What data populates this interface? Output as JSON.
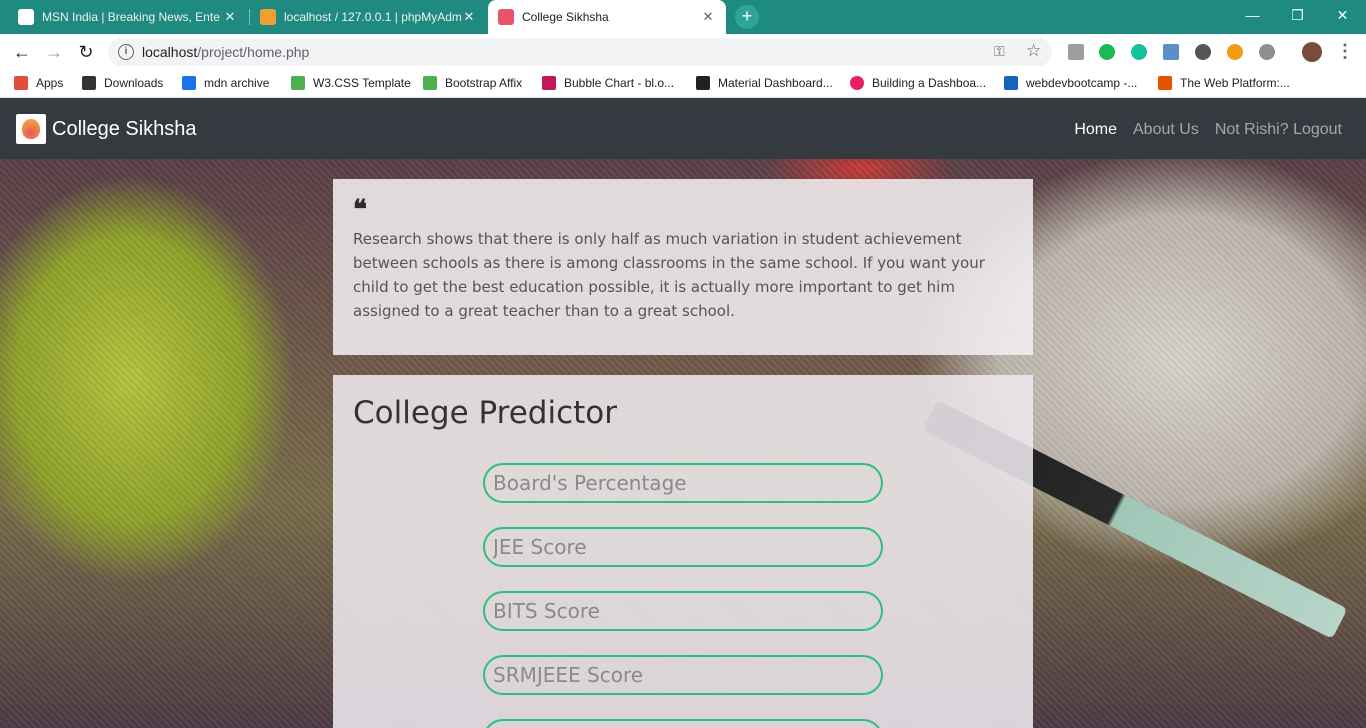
{
  "browser": {
    "tabs": [
      {
        "title": "MSN India | Breaking News, Ente",
        "close": "✕",
        "favicon_color": "#ffffff"
      },
      {
        "title": "localhost / 127.0.0.1 | phpMyAdm",
        "close": "✕",
        "favicon_color": "#f0a030"
      },
      {
        "title": "College Sikhsha",
        "close": "✕",
        "favicon_color": "#e8536a"
      }
    ],
    "new_tab": "+",
    "window_controls": {
      "minimize": "—",
      "maximize": "❐",
      "close": "✕"
    },
    "address": {
      "host": "localhost",
      "path": "/project/home.php"
    },
    "bookmarks": [
      {
        "label": "Apps",
        "icon_color": "#e34b3c"
      },
      {
        "label": "Downloads",
        "icon_color": "#333333"
      },
      {
        "label": "mdn archive",
        "icon_color": "#1a73e8"
      },
      {
        "label": "W3.CSS Template",
        "icon_color": "#4caf50"
      },
      {
        "label": "Bootstrap Affix",
        "icon_color": "#4caf50"
      },
      {
        "label": "Bubble Chart - bl.o...",
        "icon_color": "#c2185b"
      },
      {
        "label": "Material Dashboard...",
        "icon_color": "#222222"
      },
      {
        "label": "Building a Dashboa...",
        "icon_color": "#e91e63"
      },
      {
        "label": "webdevbootcamp -...",
        "icon_color": "#1565c0"
      },
      {
        "label": "The Web Platform:...",
        "icon_color": "#e65100"
      }
    ]
  },
  "site": {
    "brand": "College Sikhsha",
    "nav": {
      "home": "Home",
      "about": "About Us",
      "logout": "Not Rishi? Logout"
    },
    "quote_icon": "❝",
    "quote": "Research shows that there is only half as much variation in student achievement between schools as there is among classrooms in the same school. If you want your child to get the best education possible, it is actually more important to get him assigned to a great teacher than to a great school.",
    "predictor": {
      "title": "College Predictor",
      "fields": [
        {
          "placeholder": "Board's Percentage",
          "value": ""
        },
        {
          "placeholder": "JEE Score",
          "value": ""
        },
        {
          "placeholder": "BITS Score",
          "value": ""
        },
        {
          "placeholder": "SRMJEEE Score",
          "value": ""
        },
        {
          "placeholder": "",
          "value": ""
        }
      ]
    }
  },
  "colors": {
    "navbar": "#343a40",
    "field_border": "#2ebf7a",
    "tabbar": "#1e8a80"
  }
}
